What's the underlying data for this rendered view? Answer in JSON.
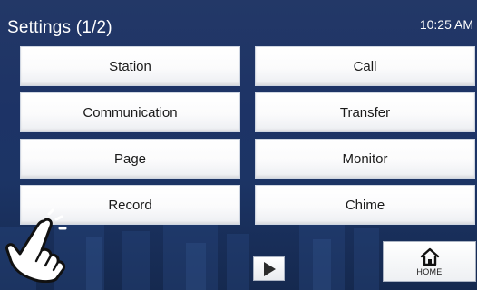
{
  "header": {
    "title": "Settings (1/2)",
    "time": "10:25 AM"
  },
  "menu": {
    "items": [
      {
        "label": "Station"
      },
      {
        "label": "Call"
      },
      {
        "label": "Communication"
      },
      {
        "label": "Transfer"
      },
      {
        "label": "Page"
      },
      {
        "label": "Monitor"
      },
      {
        "label": "Record"
      },
      {
        "label": "Chime"
      }
    ]
  },
  "footer": {
    "home_label": "HOME",
    "next_icon": "play-triangle-icon",
    "home_icon": "house-icon"
  },
  "colors": {
    "background": "#1d3366",
    "button_face": "#ffffff",
    "text_dark": "#1a1a1a",
    "text_light": "#ffffff"
  }
}
